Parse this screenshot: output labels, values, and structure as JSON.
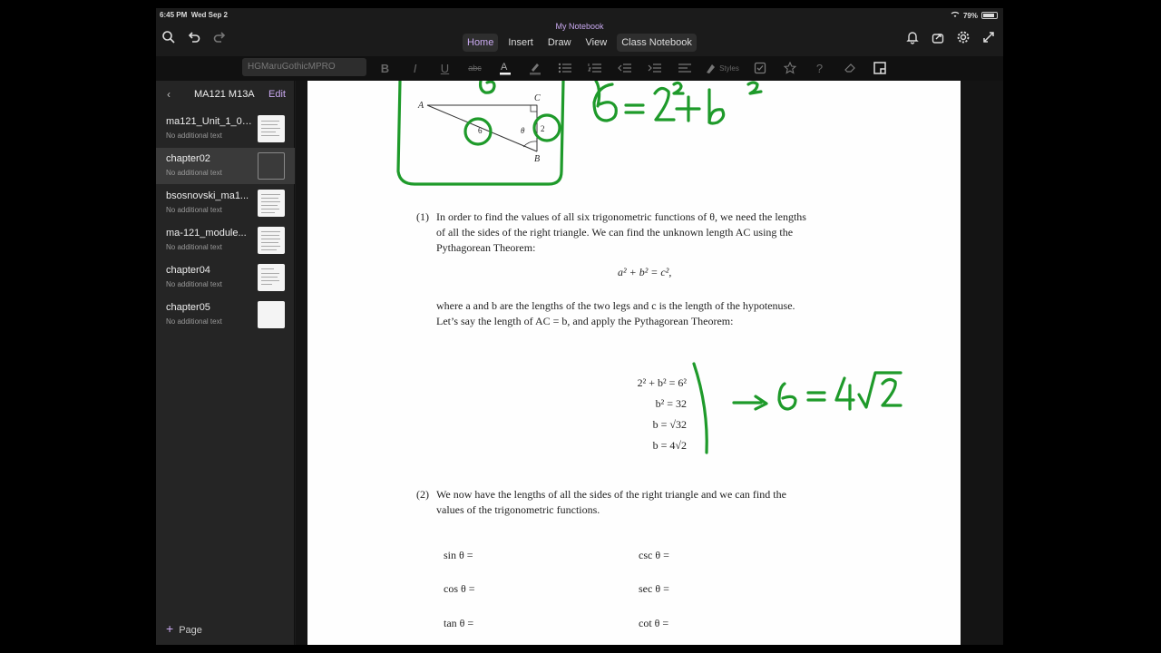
{
  "status": {
    "time": "6:45 PM",
    "date": "Wed Sep 2",
    "battery": "79%"
  },
  "app": {
    "notebook_title": "My Notebook",
    "tabs": [
      "Home",
      "Insert",
      "Draw",
      "View",
      "Class Notebook"
    ]
  },
  "ribbon": {
    "font_name": "HGMaruGothicMPRO",
    "styles_label": "Styles"
  },
  "sidebar": {
    "section_title": "MA121 M13A",
    "edit_label": "Edit",
    "add_page_label": "Page",
    "pages": [
      {
        "title": "ma121_Unit_1_08...",
        "subtitle": "No additional text"
      },
      {
        "title": "chapter02",
        "subtitle": "No additional text"
      },
      {
        "title": "bsosnovski_ma1...",
        "subtitle": "No additional text"
      },
      {
        "title": "ma-121_module...",
        "subtitle": "No additional text"
      },
      {
        "title": "chapter04",
        "subtitle": "No additional text"
      },
      {
        "title": "chapter05",
        "subtitle": "No additional text"
      }
    ]
  },
  "document": {
    "triangle_labels": {
      "a": "A",
      "b": "B",
      "c": "C",
      "side6": "6",
      "side2": "2",
      "theta": "θ"
    },
    "item1": {
      "number": "(1)",
      "line1": "In order to find the values of all six trigonometric functions of θ, we need the lengths",
      "line2": "of all the sides of the right triangle. We can find the unknown length AC using the",
      "line3": "Pythagorean Theorem:",
      "equation": "a² + b² = c²,",
      "line4": "where a and b are the lengths of the two legs and c is the length of the hypotenuse.",
      "line5": "Let’s say the length of AC = b, and apply the Pythagorean Theorem:",
      "steps": [
        "2² + b² = 6²",
        "b² = 32",
        "b = √32",
        "b = 4√2"
      ]
    },
    "item2": {
      "number": "(2)",
      "line1": "We now have the lengths of all the sides of the right triangle and we can find the",
      "line2": "values of the trigonometric functions."
    },
    "trig": {
      "sin": "sin θ =",
      "cos": "cos θ =",
      "tan": "tan θ =",
      "csc": "csc θ =",
      "sec": "sec θ =",
      "cot": "cot θ ="
    }
  },
  "colors": {
    "ink_green": "#1e9a2a",
    "accent_purple": "#c9a9f0"
  }
}
